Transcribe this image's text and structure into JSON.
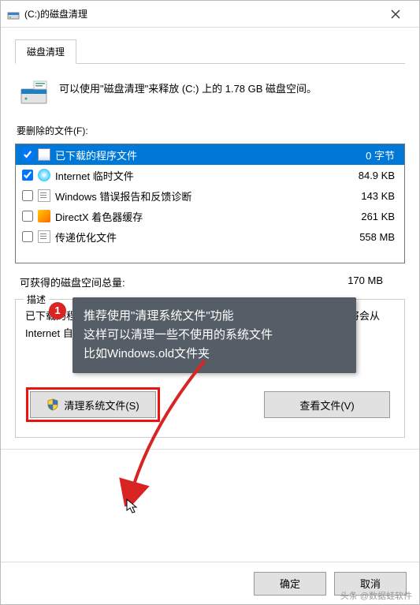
{
  "window": {
    "title": "(C:)的磁盘清理"
  },
  "tab": {
    "label": "磁盘清理"
  },
  "header": {
    "text": "可以使用\"磁盘清理\"来释放  (C:) 上的 1.78 GB 磁盘空间。"
  },
  "filesLabel": "要删除的文件(F):",
  "files": [
    {
      "checked": true,
      "iconClass": "ico-blank",
      "name": "已下载的程序文件",
      "size": "0 字节",
      "selected": true
    },
    {
      "checked": true,
      "iconClass": "ico-ie",
      "name": "Internet 临时文件",
      "size": "84.9 KB"
    },
    {
      "checked": false,
      "iconClass": "ico-page",
      "name": "Windows 错误报告和反馈诊断",
      "size": "143 KB"
    },
    {
      "checked": false,
      "iconClass": "ico-dx",
      "name": "DirectX 着色器缓存",
      "size": "261 KB"
    },
    {
      "checked": false,
      "iconClass": "ico-page",
      "name": "传递优化文件",
      "size": "558 MB"
    }
  ],
  "total": {
    "label": "可获得的磁盘空间总量:",
    "value": "170 MB"
  },
  "description": {
    "title": "描述",
    "text": "已下载的程序文件包括 ActiveX 控件和 Java 小程序，你查看特定网页时将会从 Internet 自动下载它们，并临时保存在硬盘上的已下载的程序文件夹中。"
  },
  "buttons": {
    "cleanSystem": "清理系统文件(S)",
    "viewFiles": "查看文件(V)",
    "ok": "确定",
    "cancel": "取消"
  },
  "annotation": {
    "number": "1",
    "line1": "推荐使用\"清理系统文件\"功能",
    "line2": "这样可以清理一些不使用的系统文件",
    "line3": "比如Windows.old文件夹"
  },
  "attribution": "头条 @数据蛙软件"
}
